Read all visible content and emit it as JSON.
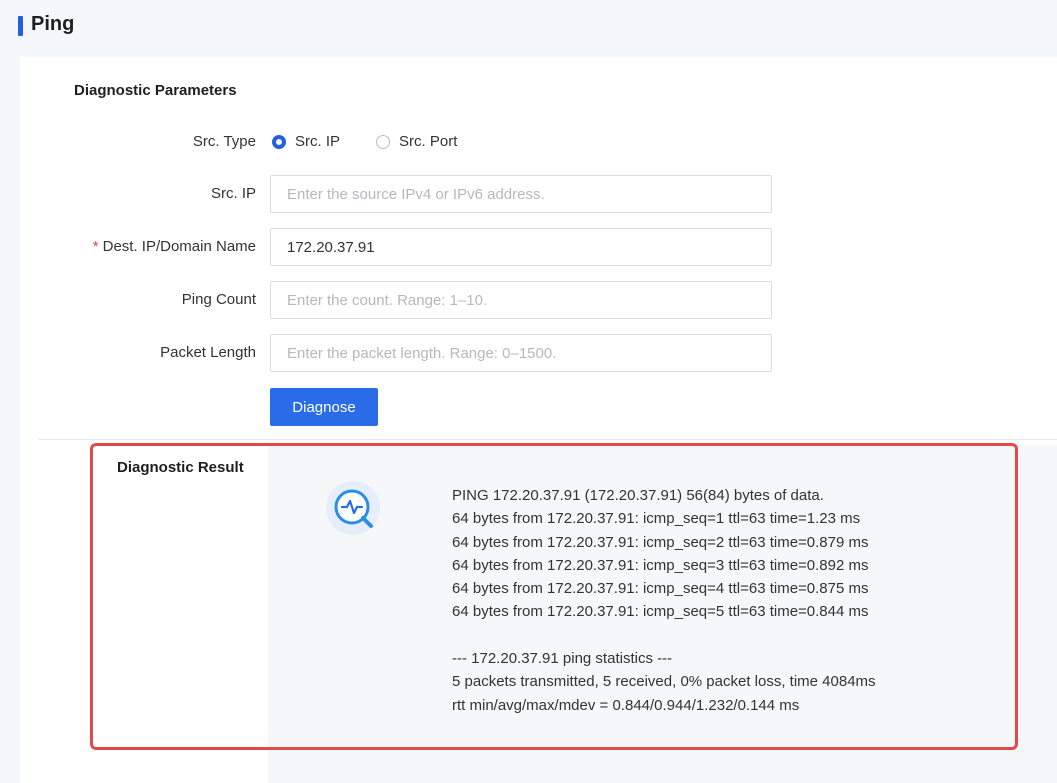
{
  "header": {
    "title": "Ping"
  },
  "params": {
    "section_title": "Diagnostic Parameters",
    "src_type": {
      "label": "Src. Type",
      "options": [
        "Src. IP",
        "Src. Port"
      ],
      "selected": "Src. IP"
    },
    "src_ip": {
      "label": "Src. IP",
      "value": "",
      "placeholder": "Enter the source IPv4 or IPv6 address."
    },
    "dest": {
      "required_mark": "*",
      "label": "Dest. IP/Domain Name",
      "value": "172.20.37.91",
      "placeholder": ""
    },
    "ping_count": {
      "label": "Ping Count",
      "value": "",
      "placeholder": "Enter the count. Range: 1–10."
    },
    "packet_length": {
      "label": "Packet Length",
      "value": "",
      "placeholder": "Enter the packet length. Range: 0–1500."
    },
    "diagnose_label": "Diagnose"
  },
  "result": {
    "label": "Diagnostic Result",
    "icon": "diagnosis-search-icon",
    "lines": [
      "PING 172.20.37.91 (172.20.37.91) 56(84) bytes of data.",
      "64 bytes from 172.20.37.91: icmp_seq=1 ttl=63 time=1.23 ms",
      "64 bytes from 172.20.37.91: icmp_seq=2 ttl=63 time=0.879 ms",
      "64 bytes from 172.20.37.91: icmp_seq=3 ttl=63 time=0.892 ms",
      "64 bytes from 172.20.37.91: icmp_seq=4 ttl=63 time=0.875 ms",
      "64 bytes from 172.20.37.91: icmp_seq=5 ttl=63 time=0.844 ms",
      "",
      "--- 172.20.37.91 ping statistics ---",
      "5 packets transmitted, 5 received, 0% packet loss, time 4084ms",
      "rtt min/avg/max/mdev = 0.844/0.944/1.232/0.144 ms"
    ]
  },
  "colors": {
    "accent": "#2260e3",
    "highlight": "#e24a4a",
    "required": "#e0473b"
  }
}
